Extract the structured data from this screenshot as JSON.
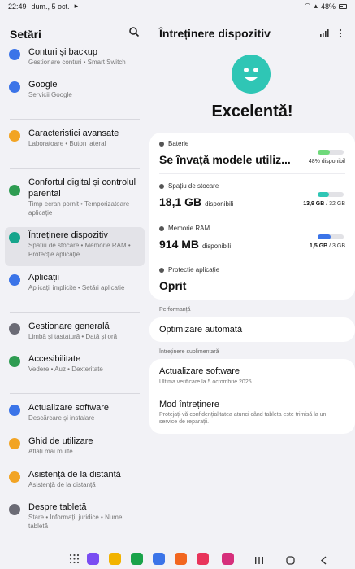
{
  "status_bar": {
    "time": "22:49",
    "date": "dum., 5 oct.",
    "battery": "48%"
  },
  "left_panel": {
    "title": "Setări",
    "items": [
      {
        "title": "Conturi și backup",
        "subtitle": "Gestionare conturi  •  Smart Switch",
        "icon": "sync-icon",
        "color": "#3b74e8"
      },
      {
        "title": "Google",
        "subtitle": "Servicii Google",
        "icon": "google-icon",
        "color": "#3b74e8"
      },
      {
        "title": "Caracteristici avansate",
        "subtitle": "Laboratoare  •  Buton lateral",
        "icon": "star-icon",
        "color": "#f2a424"
      },
      {
        "title": "Confortul digital și controlul parental",
        "subtitle": "Timp ecran pornit  •  Temporizatoare aplicație",
        "icon": "wellbeing-icon",
        "color": "#2e9c52"
      },
      {
        "title": "Întreținere dispozitiv",
        "subtitle": "Spațiu de stocare  •  Memorie RAM  •  Protecție aplicație",
        "icon": "device-care-icon",
        "color": "#16a58c"
      },
      {
        "title": "Aplicații",
        "subtitle": "Aplicații implicite  •  Setări aplicație",
        "icon": "apps-icon",
        "color": "#3b74e8"
      },
      {
        "title": "Gestionare generală",
        "subtitle": "Limbă și tastatură  •  Dată și oră",
        "icon": "sliders-icon",
        "color": "#6b6b75"
      },
      {
        "title": "Accesibilitate",
        "subtitle": "Vedere  •  Auz  •  Dexteritate",
        "icon": "accessibility-icon",
        "color": "#2e9c52"
      },
      {
        "title": "Actualizare software",
        "subtitle": "Descărcare și instalare",
        "icon": "update-icon",
        "color": "#3b74e8"
      },
      {
        "title": "Ghid de utilizare",
        "subtitle": "Aflați mai multe",
        "icon": "guide-icon",
        "color": "#f2a424"
      },
      {
        "title": "Asistență de la distanță",
        "subtitle": "Asistență de la distanță",
        "icon": "support-icon",
        "color": "#f2a424"
      },
      {
        "title": "Despre tabletă",
        "subtitle": "Stare  •  Informații juridice  •  Nume tabletă",
        "icon": "info-icon",
        "color": "#6b6b75"
      }
    ]
  },
  "right_panel": {
    "title": "Întreținere dispozitiv",
    "overall_status": "Excelentă!",
    "battery": {
      "label": "Baterie",
      "value": "Se învață modele utiliz...",
      "bar_text": "48% disponibil",
      "level": 0.48,
      "color": "#6fd97a"
    },
    "storage": {
      "label": "Spațiu de stocare",
      "value": "18,1 GB",
      "unit": "disponibili",
      "used": "13,9 GB",
      "total": "/ 32 GB",
      "level": 0.43,
      "color": "#2fc6b5"
    },
    "ram": {
      "label": "Memorie RAM",
      "value": "914 MB",
      "unit": "disponibili",
      "used": "1,5 GB",
      "total": "/ 3 GB",
      "level": 0.5,
      "color": "#3b74e8"
    },
    "protection": {
      "label": "Protecție aplicație",
      "value": "Oprit"
    },
    "performance_section": "Performanță",
    "auto_optimize": "Optimizare automată",
    "extra_section": "Întreținere suplimentară",
    "software_update": {
      "title": "Actualizare software",
      "subtitle": "Ultima verificare la 5 octombrie 2025"
    },
    "maintenance_mode": {
      "title": "Mod întreținere",
      "subtitle": "Protejați-vă confidențialitatea atunci când tableta este trimisă la un service de reparații."
    }
  },
  "navigation_bar": {
    "apps": [
      {
        "name": "app-drawer-icon",
        "color": "#444"
      },
      {
        "name": "galaxy-store-icon",
        "color": "#7a4df2"
      },
      {
        "name": "my-files-icon",
        "color": "#f2b300"
      },
      {
        "name": "phone-icon",
        "color": "#1aa34a"
      },
      {
        "name": "messages-icon",
        "color": "#3b74e8"
      },
      {
        "name": "contacts-icon",
        "color": "#f2661f"
      },
      {
        "name": "camera-icon",
        "color": "#e8345a"
      },
      {
        "name": "gallery-icon",
        "color": "#d62f7b"
      }
    ]
  }
}
